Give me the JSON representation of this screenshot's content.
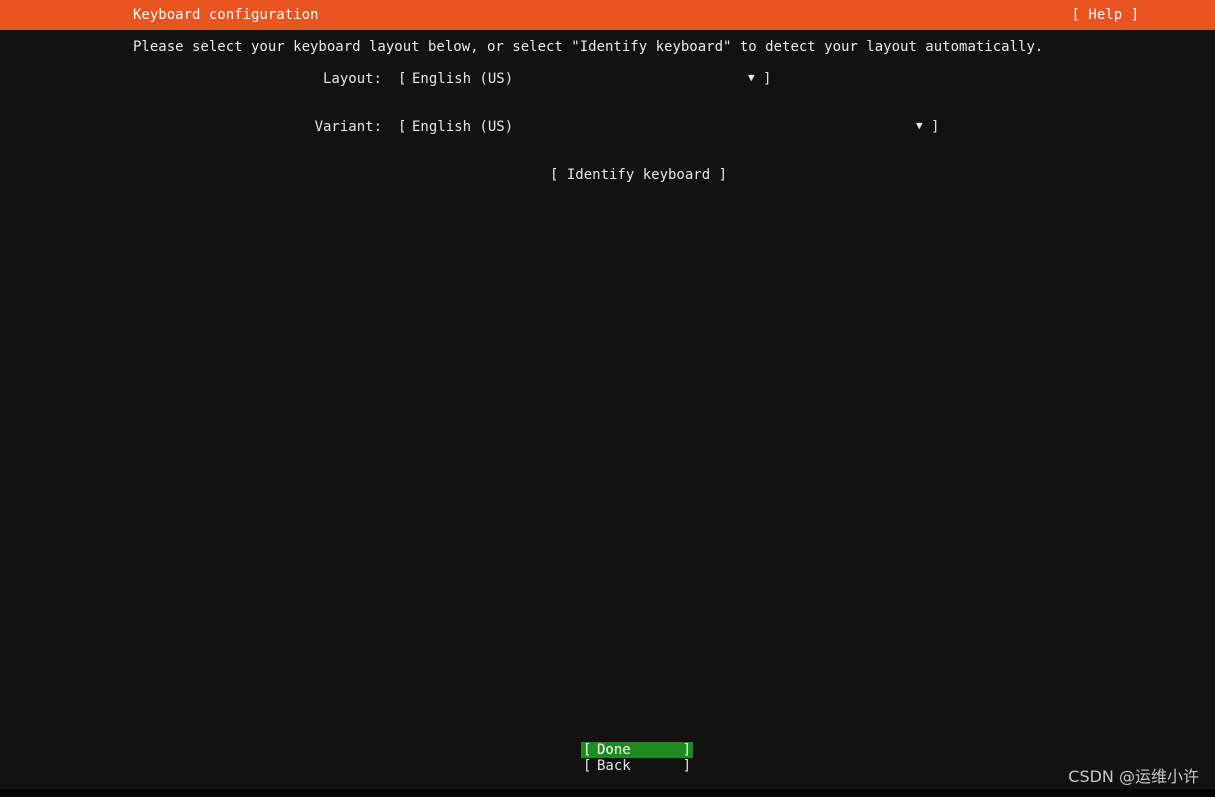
{
  "header": {
    "title": "Keyboard configuration",
    "help_label": "[ Help ]",
    "bg_color": "#e95420"
  },
  "intro": "Please select your keyboard layout below, or select \"Identify keyboard\" to detect your layout automatically.",
  "layout": {
    "label": "Layout:",
    "open_bracket": "[",
    "value": "English (US)",
    "arrow_icon": "▼",
    "close_bracket": "]"
  },
  "variant": {
    "label": "Variant:",
    "open_bracket": "[",
    "value": "English (US)",
    "arrow_icon": "▼",
    "close_bracket": "]"
  },
  "identify_button": "[ Identify keyboard ]",
  "buttons": {
    "done": {
      "open": "[",
      "label": "Done",
      "close": "]",
      "bg_color": "#1f8a1f"
    },
    "back": {
      "open": "[",
      "label": "Back",
      "close": "]"
    }
  },
  "watermark": "CSDN @运维小许"
}
